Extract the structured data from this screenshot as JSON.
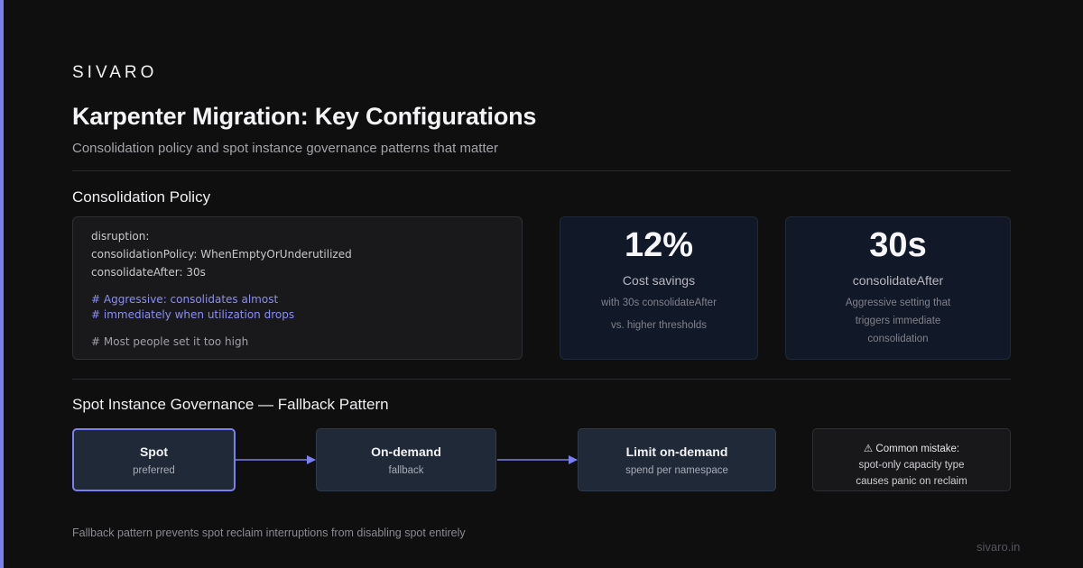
{
  "brand": "SIVARO",
  "title": "Karpenter Migration: Key Configurations",
  "subtitle": "Consolidation policy and spot instance governance patterns that matter",
  "consolidation": {
    "section_title": "Consolidation Policy",
    "code_lines": [
      "disruption:",
      "consolidationPolicy: WhenEmptyOrUnderutilized",
      "consolidateAfter: 30s",
      "# Aggressive: consolidates almost",
      "# immediately when utilization drops",
      "# Most people set it too high"
    ],
    "stats": [
      {
        "value": "12%",
        "label": "Cost savings",
        "desc": [
          "with 30s consolidateAfter",
          "vs. higher thresholds"
        ]
      },
      {
        "value": "30s",
        "label": "consolidateAfter",
        "desc": [
          "Aggressive setting that",
          "triggers immediate",
          "consolidation"
        ]
      }
    ]
  },
  "spot": {
    "section_title": "Spot Instance Governance — Fallback Pattern",
    "flow": [
      {
        "title": "Spot",
        "sub": "preferred"
      },
      {
        "title": "On-demand",
        "sub": "fallback"
      },
      {
        "title": "Limit on-demand",
        "sub": "spend per namespace"
      }
    ],
    "warning": {
      "icon": "warning-icon",
      "title": "Common mistake:",
      "lines": [
        "spot-only capacity type",
        "causes panic on reclaim"
      ]
    },
    "footer_note": "Fallback pattern prevents spot reclaim interruptions from disabling spot entirely"
  },
  "site": "sivaro.in",
  "colors": {
    "accent": "#7c7ff0",
    "background": "#0f0f10",
    "stat_card": "#111827",
    "flow_box": "#1f2937"
  }
}
